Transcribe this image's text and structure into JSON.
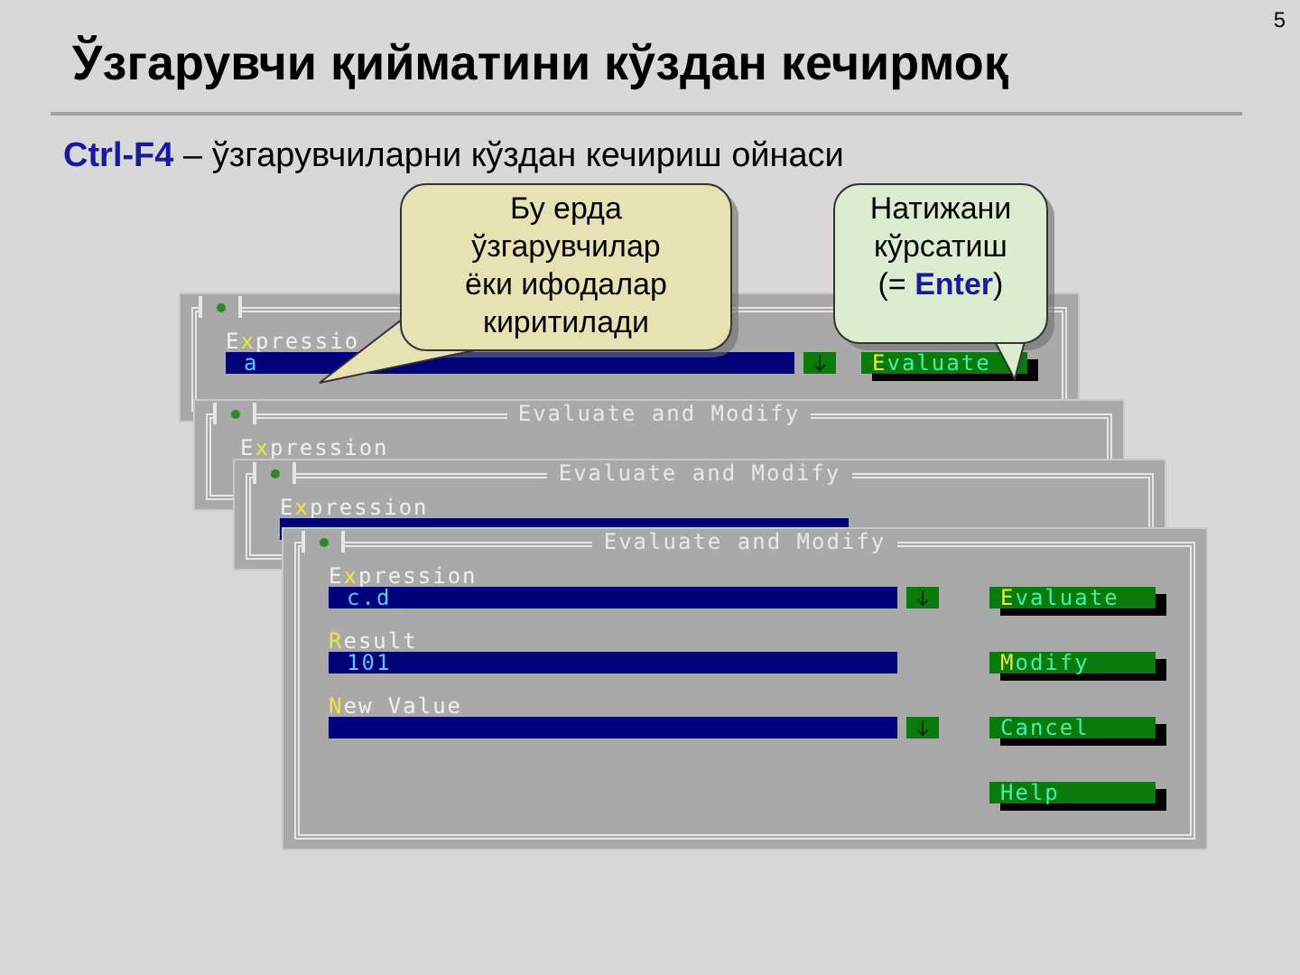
{
  "page_number": "5",
  "title": "Ўзгарувчи қийматини кўздан кечирмоқ",
  "subtitle": {
    "shortcut": "Ctrl-F4",
    "text": "– ўзгарувчиларни кўздан кечириш ойнаси"
  },
  "dialogs": [
    {
      "fields": [
        {
          "label": {
            "before": "E",
            "key": "x",
            "after": "pressio"
          },
          "has_input": true,
          "value": "a",
          "history_arrow": true
        }
      ],
      "buttons": [
        {
          "key": "E",
          "after": "valuate"
        }
      ]
    },
    {
      "title": "Evaluate and Modify",
      "fields": [
        {
          "label": {
            "before": "E",
            "key": "x",
            "after": "pression"
          },
          "has_input": false
        }
      ]
    },
    {
      "title": "Evaluate and Modify",
      "fields": [
        {
          "label": {
            "before": "E",
            "key": "x",
            "after": "pression"
          },
          "has_input": true
        }
      ]
    },
    {
      "title": "Evaluate and Modify",
      "fields": [
        {
          "label": {
            "before": "E",
            "key": "x",
            "after": "pression"
          },
          "has_input": true,
          "value": "c.d_",
          "history_arrow": true
        },
        {
          "label": {
            "key": "R",
            "after": "esult"
          },
          "has_input": true,
          "value": "101",
          "history_arrow": false
        },
        {
          "label": {
            "key": "N",
            "after": "ew Value"
          },
          "has_input": true,
          "history_arrow": true
        }
      ],
      "buttons": [
        {
          "key": "E",
          "after": "valuate"
        },
        {
          "key": "M",
          "after": "odify"
        },
        {
          "before": "Cancel"
        },
        {
          "before": "Help"
        }
      ]
    }
  ],
  "callouts": [
    {
      "lines": [
        [
          {
            "kind": "plain",
            "text": "Бу ерда"
          }
        ],
        [
          {
            "kind": "plain",
            "text": "ўзгарувчилар"
          }
        ],
        [
          {
            "kind": "plain",
            "text": "ёки ифодалар"
          }
        ],
        [
          {
            "kind": "plain",
            "text": "киритилади"
          }
        ]
      ]
    },
    {
      "lines": [
        [
          {
            "kind": "plain",
            "text": "Натижани"
          }
        ],
        [
          {
            "kind": "plain",
            "text": "кўрсатиш"
          }
        ],
        [
          {
            "kind": "plain",
            "text": "(= "
          },
          {
            "kind": "key",
            "text": "Enter"
          },
          {
            "kind": "plain",
            "text": ")"
          }
        ]
      ]
    }
  ]
}
